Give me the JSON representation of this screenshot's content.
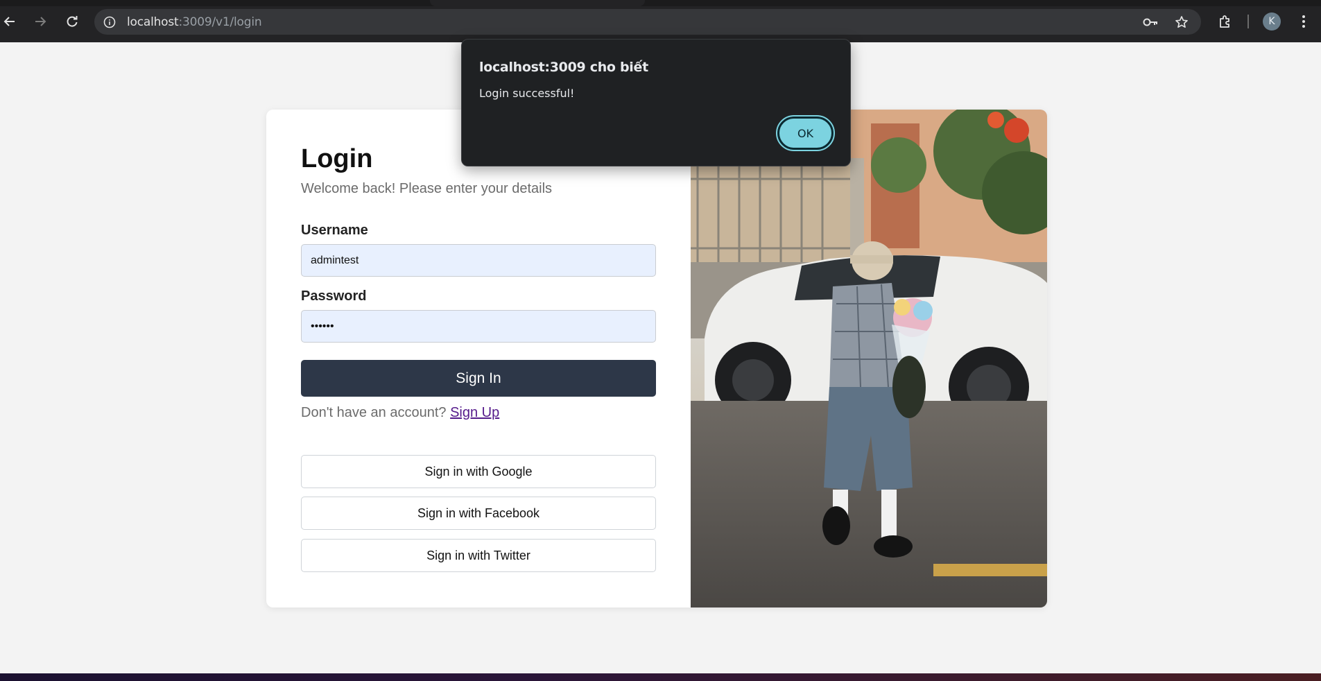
{
  "browser": {
    "url_host": "localhost",
    "url_rest": ":3009/v1/login",
    "avatar_initial": "K",
    "icons": [
      "back-arrow-icon",
      "forward-arrow-icon",
      "reload-icon",
      "site-info-icon",
      "password-key-icon",
      "bookmark-star-icon",
      "extensions-icon",
      "kebab-menu-icon"
    ]
  },
  "login": {
    "title": "Login",
    "subtitle": "Welcome back! Please enter your details",
    "username_label": "Username",
    "username_value": "admintest",
    "password_label": "Password",
    "password_value": "••••••",
    "signin_label": "Sign In",
    "no_account_text": "Don't have an account?",
    "signup_label": "Sign Up",
    "google_label": "Sign in with Google",
    "facebook_label": "Sign in with Facebook",
    "twitter_label": "Sign in with Twitter"
  },
  "alert": {
    "title": "localhost:3009 cho biết",
    "message": "Login successful!",
    "ok_label": "OK"
  },
  "colors": {
    "primary_button": "#2d3748",
    "input_bg": "#e8f0fe",
    "alert_ok": "#7cd3e0",
    "link": "#551a8b"
  }
}
